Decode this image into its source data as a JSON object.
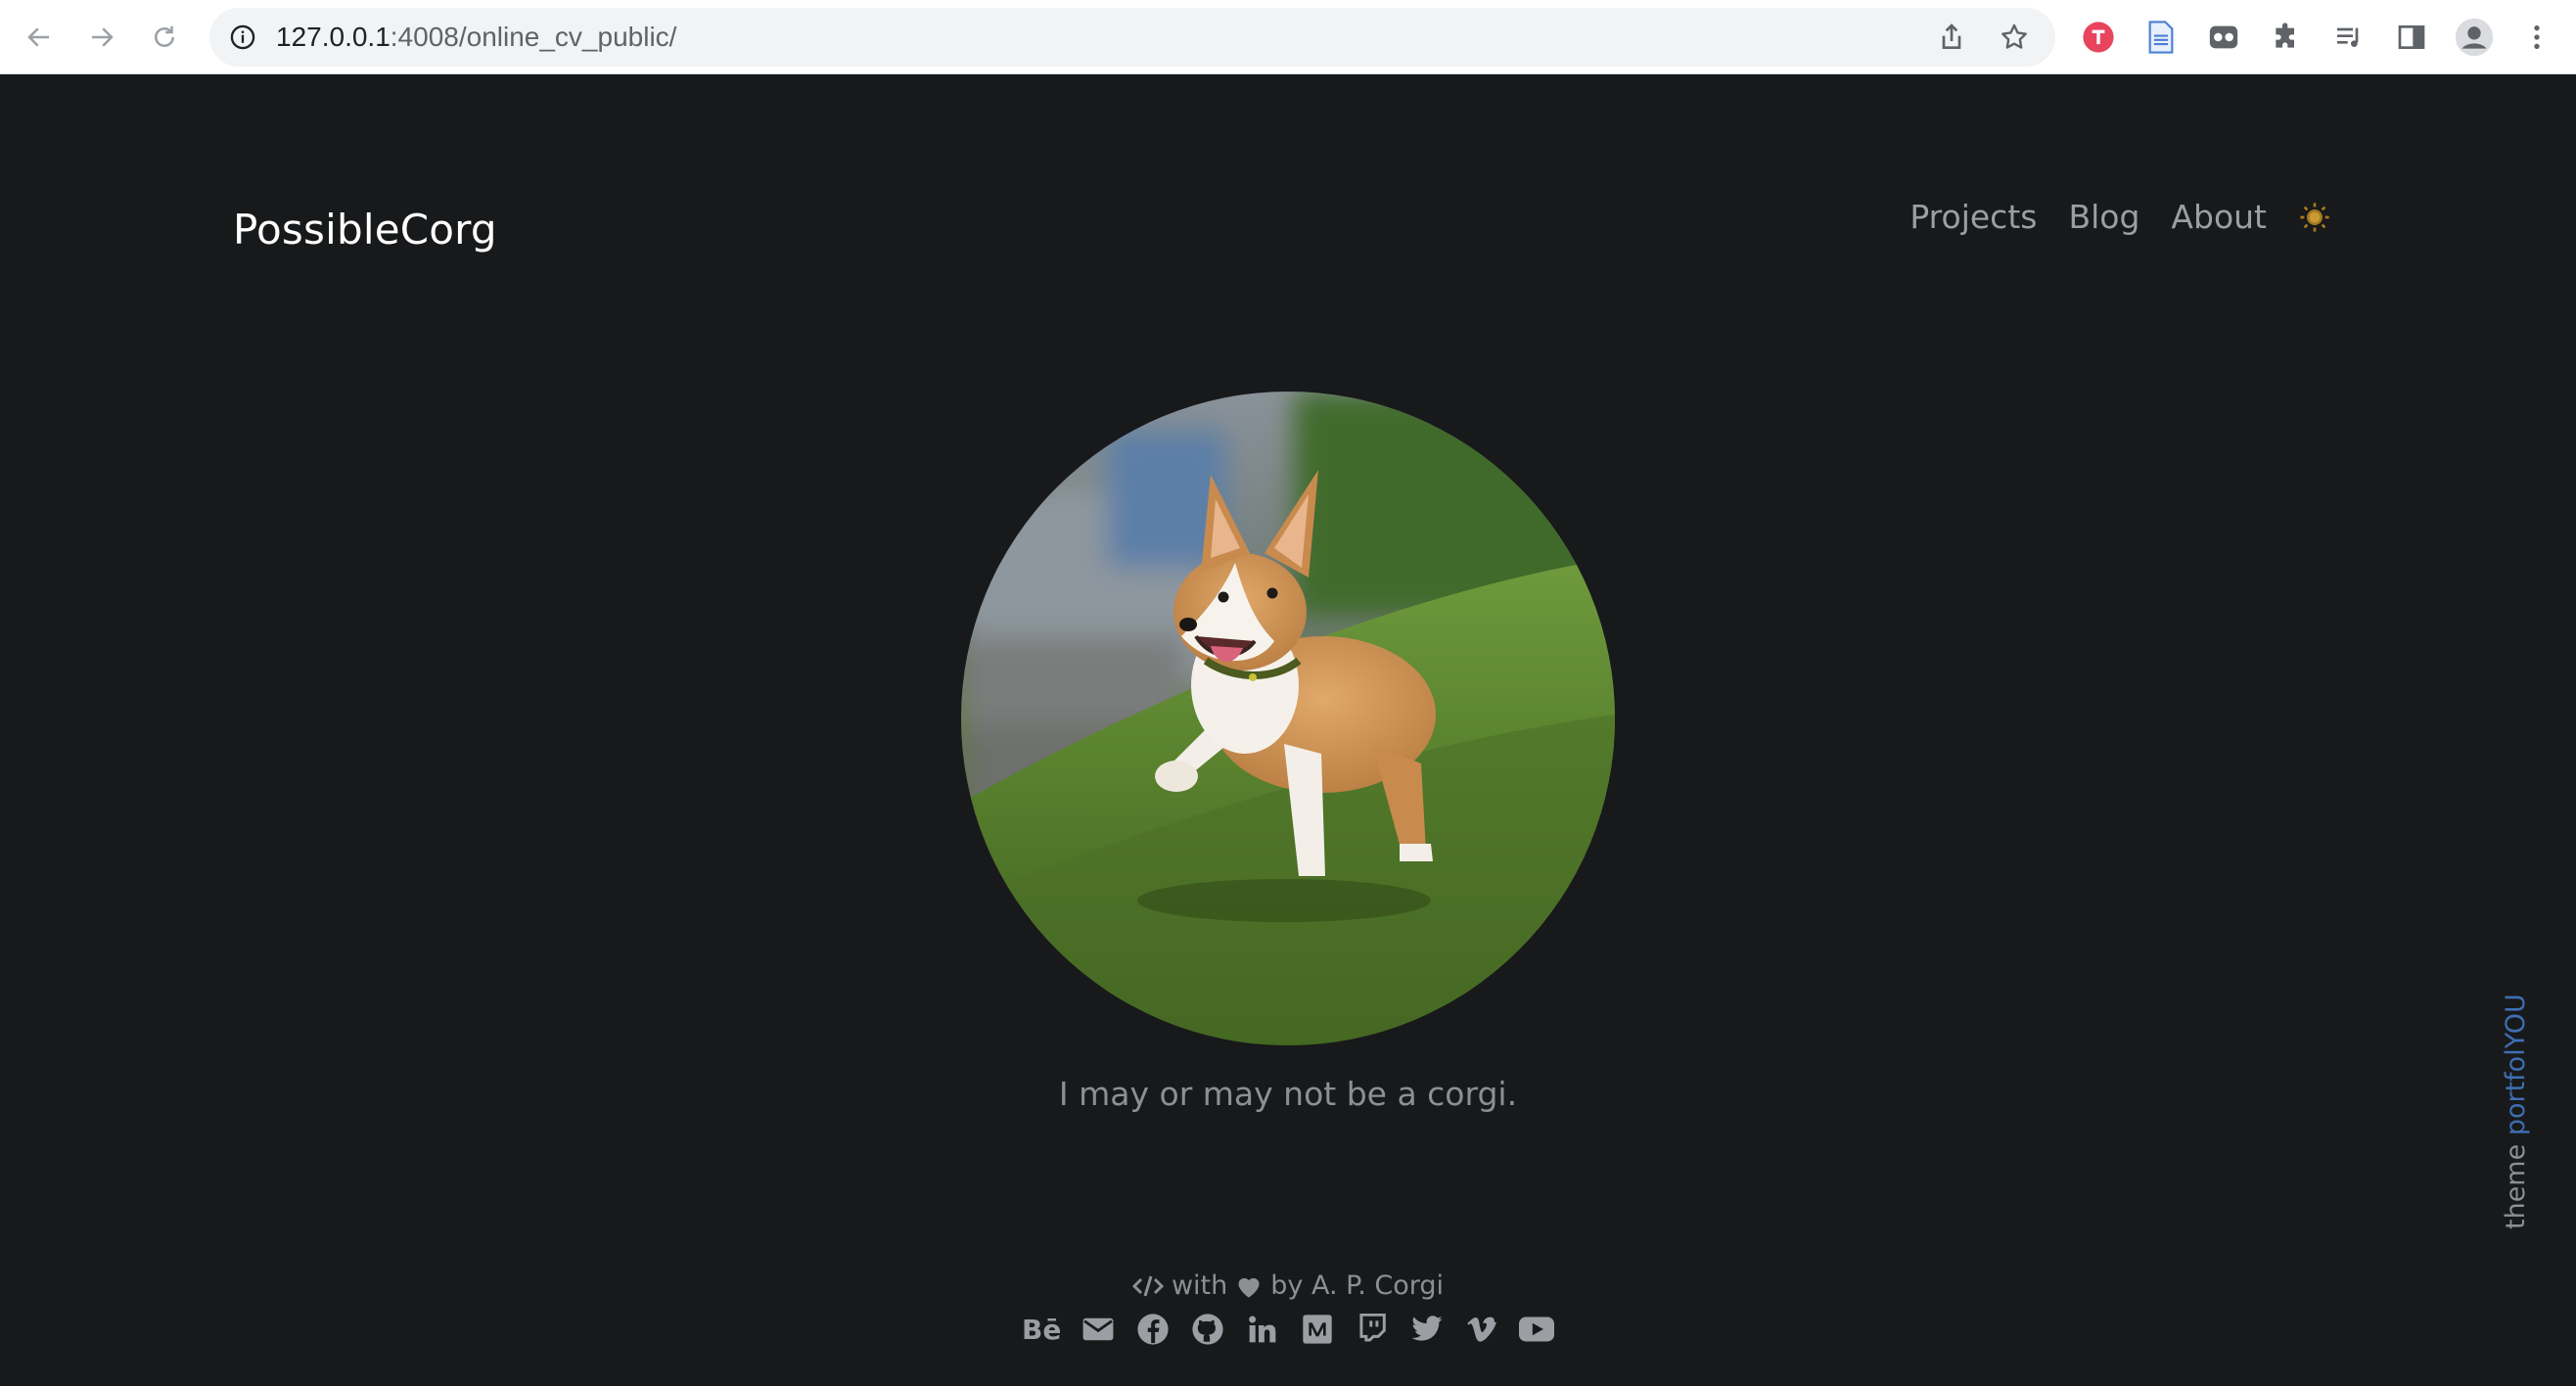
{
  "browser": {
    "url_host": "127.0.0.1",
    "url_rest": ":4008/online_cv_public/"
  },
  "site": {
    "brand": "PossibleCorg",
    "nav": [
      {
        "label": "Projects"
      },
      {
        "label": "Blog"
      },
      {
        "label": "About"
      }
    ],
    "tagline": "I may or may not be a corgi.",
    "footer": {
      "with": "with",
      "by": "by A. P. Corgi",
      "socials": [
        "behance",
        "email",
        "facebook",
        "github",
        "linkedin",
        "medium",
        "twitch",
        "twitter",
        "vimeo",
        "youtube"
      ],
      "behance_label": "Bē"
    },
    "side_credit": {
      "prefix": "theme",
      "link": "portfolYOU"
    }
  },
  "colors": {
    "page_bg": "#18191b",
    "text_muted": "#8c8f94",
    "link_blue": "#3e6fb3",
    "chrome_bg": "#ffffff"
  }
}
